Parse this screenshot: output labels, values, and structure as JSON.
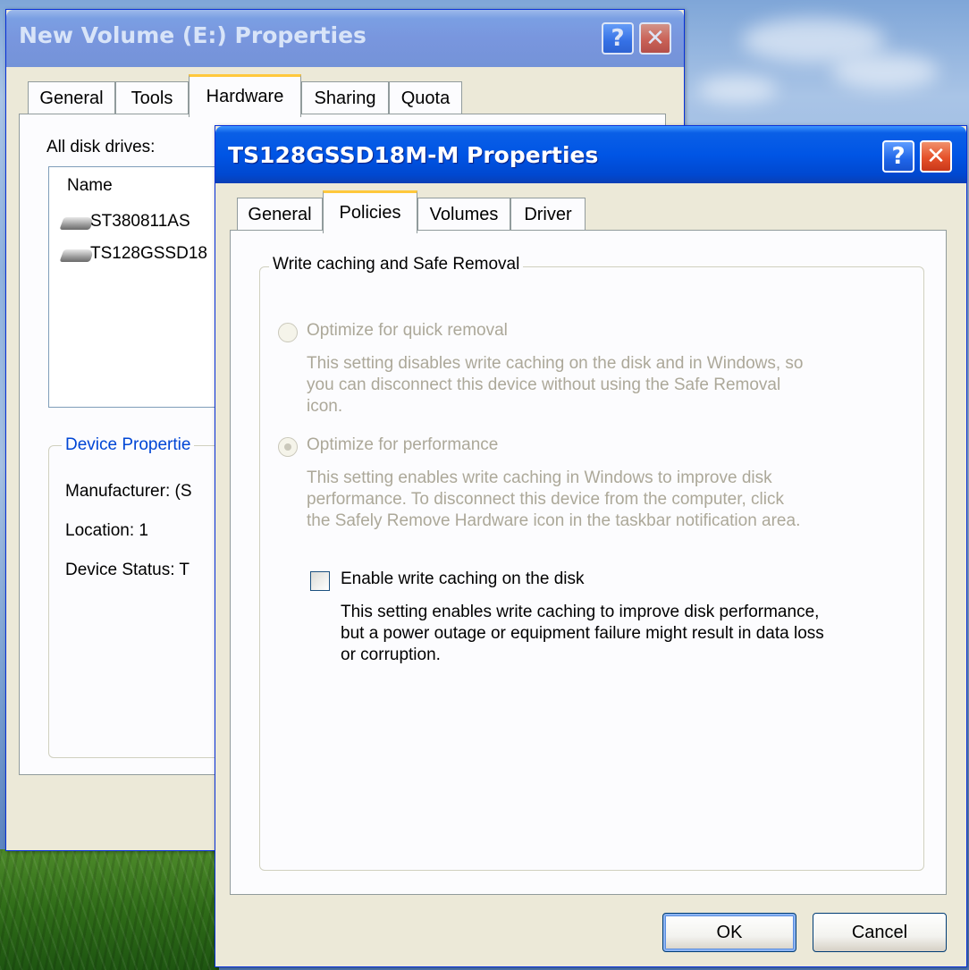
{
  "back_window": {
    "title": "New Volume (E:) Properties",
    "tabs": [
      "General",
      "Tools",
      "Hardware",
      "Sharing",
      "Quota"
    ],
    "active_tab": "Hardware",
    "disk_drives_label": "All disk drives:",
    "list_header_name": "Name",
    "drives": [
      "ST380811AS",
      "TS128GSSD18"
    ],
    "device_properties_label": "Device Propertie",
    "manufacturer": "Manufacturer: (S",
    "location": "Location: 1",
    "device_status": "Device Status: T"
  },
  "front_window": {
    "title": "TS128GSSD18M-M Properties",
    "tabs": [
      "General",
      "Policies",
      "Volumes",
      "Driver"
    ],
    "active_tab": "Policies",
    "group_title": "Write caching and Safe Removal",
    "option_quick_removal": {
      "label": "Optimize for quick removal",
      "desc_lines": [
        "This setting disables write caching on the disk and in Windows, so",
        "you can disconnect this device without using the Safe Removal",
        "icon."
      ],
      "checked": false,
      "enabled": false
    },
    "option_performance": {
      "label": "Optimize for performance",
      "desc_lines": [
        "This setting enables write caching in Windows to improve disk",
        "performance. To disconnect this device from the computer, click",
        "the Safely Remove Hardware icon in the taskbar notification area."
      ],
      "checked": true,
      "enabled": false
    },
    "write_caching": {
      "label": "Enable write caching on the disk",
      "desc_lines": [
        "This setting enables write caching to improve disk performance,",
        "but a power outage or equipment failure might result in data loss",
        "or corruption."
      ],
      "checked": false
    },
    "ok_label": "OK",
    "cancel_label": "Cancel"
  },
  "titlebar_buttons": {
    "help": "?",
    "close": "✕"
  },
  "colors": {
    "titlebar_active": "#0055e5",
    "window_face": "#ece9d8",
    "tab_highlight": "#ffc83c",
    "disabled_text": "#aca899"
  }
}
